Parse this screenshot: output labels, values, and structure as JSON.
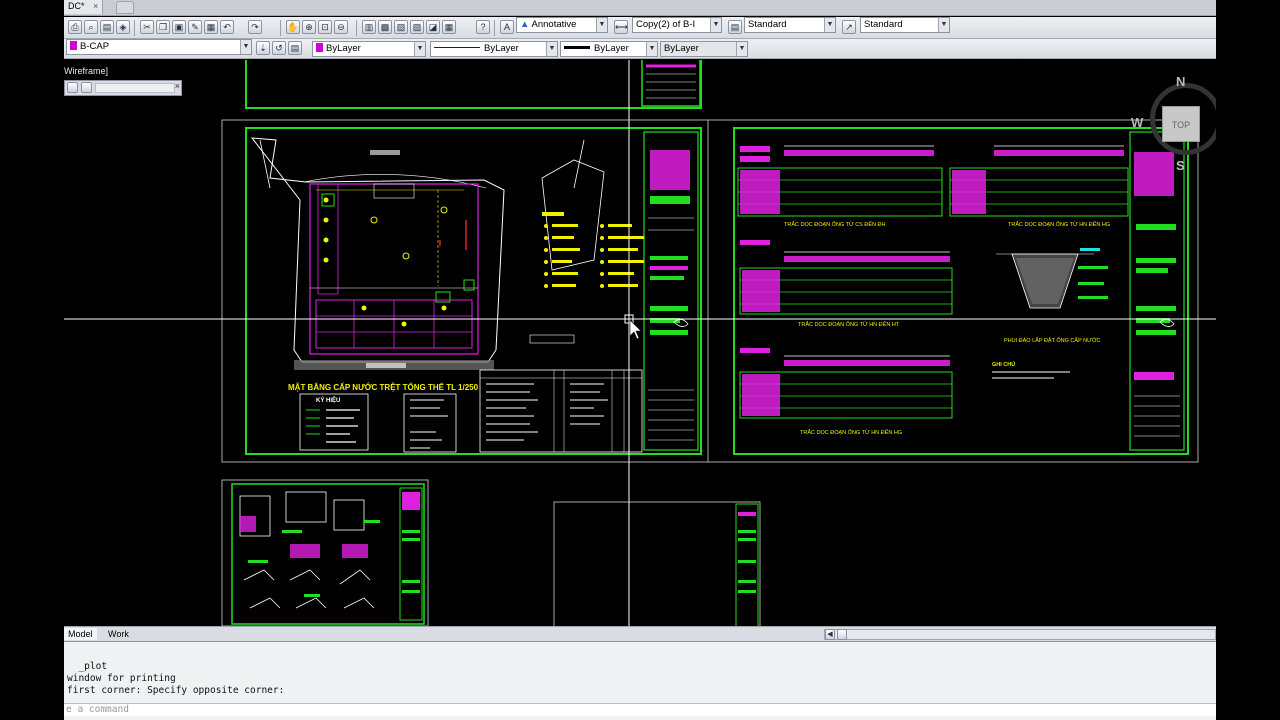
{
  "title_bar": {
    "doc_tab": "DC*",
    "doc_tab_close": "×"
  },
  "toolbar1": {
    "annotative_scale": "Annotative",
    "dim_style": "Copy(2) of B-I",
    "text_style": "Standard",
    "multileader_style": "Standard"
  },
  "toolbar2": {
    "layer": "B-CAP",
    "color": "ByLayer",
    "linetype": "ByLayer",
    "lineweight": "ByLayer",
    "plot_style": "ByLayer"
  },
  "viewport": {
    "visual_style_label": "Wireframe]"
  },
  "viewcube": {
    "north": "N",
    "west": "W",
    "south": "S",
    "top_face": "TOP"
  },
  "layout_tabs": [
    {
      "label": "Model"
    },
    {
      "label": "Work"
    }
  ],
  "command_window": {
    "lines": [
      "  _plot",
      "window for printing",
      "first corner: Specify opposite corner:"
    ],
    "prompt": "e a command"
  },
  "drawing_text": {
    "plan_title": "MẶT BẰNG CẤP NƯỚC TRỆT TỔNG THỂ  TL 1/250",
    "legend_title": "KÝ HIỆU",
    "section1_title": "TRẮC DỌC ĐOẠN ỐNG TỪ CS ĐẾN ĐH",
    "section2_title": "TRẮC DỌC ĐOẠN ỐNG TỪ HN ĐẾN HG",
    "section3_title": "TRẮC DỌC ĐOẠN ỐNG TỪ HN ĐẾN HT",
    "section4_title": "TRẮC DỌC ĐOẠN ỐNG TỪ HN ĐẾN HG",
    "trench_title": "PHUI ĐÀO LẮP ĐẶT ỐNG CẤP NƯỚC",
    "notes_title": "GHI CHÚ"
  },
  "colors": {
    "sheet_border": "#22dd22",
    "magenta": "#e020e0",
    "yellow": "#f0f000",
    "white": "#ffffff",
    "cyan": "#20e0e0",
    "background": "#000000"
  }
}
